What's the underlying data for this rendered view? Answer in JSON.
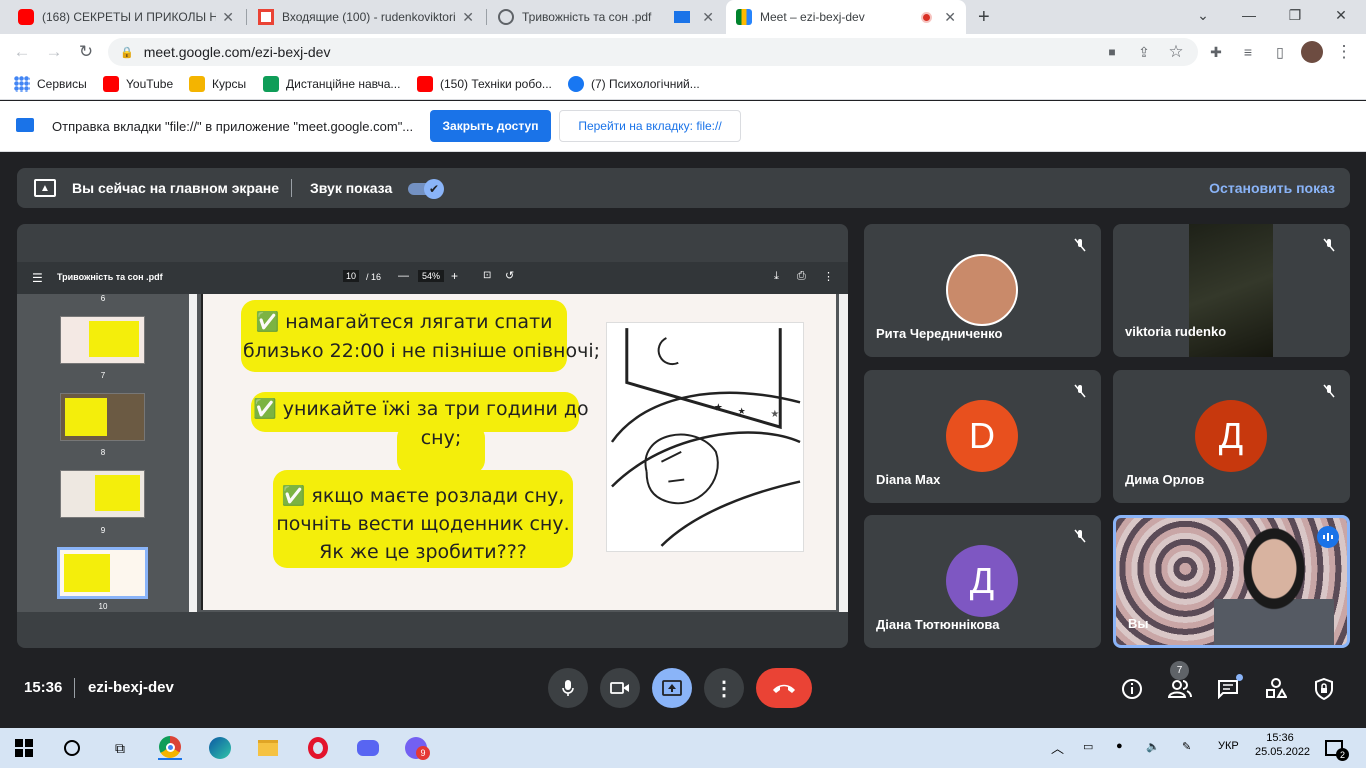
{
  "browser": {
    "tabs": [
      {
        "title": "(168) СЕКРЕТЫ И ПРИКОЛЫ НО",
        "icon": "youtube-icon"
      },
      {
        "title": "Входящие (100) - rudenkoviktori",
        "icon": "gmail-icon"
      },
      {
        "title": "Тривожність та сон .pdf",
        "icon": "globe-icon"
      },
      {
        "title": "Meet – ezi-bexj-dev",
        "icon": "meet-icon",
        "active": true
      }
    ],
    "url": "meet.google.com/ezi-bexj-dev",
    "bookmarks": [
      {
        "label": "Сервисы",
        "color": "#4285f4"
      },
      {
        "label": "YouTube",
        "color": "#ff0000"
      },
      {
        "label": "Курсы",
        "color": "#f4b400"
      },
      {
        "label": "Дистанційне навча...",
        "color": "#0f9d58"
      },
      {
        "label": "(150) Техніки робо...",
        "color": "#ff0000"
      },
      {
        "label": "(7) Психологічний...",
        "color": "#1877f2"
      }
    ],
    "infobar": {
      "message": "Отправка вкладки \"file://\" в приложение \"meet.google.com\"...",
      "primary": "Закрыть доступ",
      "secondary": "Перейти на вкладку: file://"
    }
  },
  "meet": {
    "present_bar": {
      "status": "Вы сейчас на главном экране",
      "sound_label": "Звук показа",
      "sound_on": true,
      "stop": "Остановить показ"
    },
    "pdf": {
      "filename": "Тривожність та сон .pdf",
      "page": "10",
      "pages": "/ 16",
      "zoom": "54%",
      "thumbnails": [
        "6",
        "7",
        "8",
        "9",
        "10"
      ],
      "slide_lines": {
        "l1": "✅ намагайтеся лягати спати",
        "l2": "близько 22:00 і не пізніше опівночі;",
        "l3": "✅ уникайте їжі за три години до",
        "l4": "сну;",
        "l5": "✅ якщо маєте розлади сну,",
        "l6": "почніть вести щоденник сну.",
        "l7": "Як же це зробити???"
      }
    },
    "participants": [
      {
        "name": "Рита Чередниченко",
        "type": "photo"
      },
      {
        "name": "viktoria rudenko",
        "type": "video"
      },
      {
        "name": "Diana Max",
        "initial": "D",
        "color": "#e8501e"
      },
      {
        "name": "Дима Орлов",
        "initial": "Д",
        "color": "#c7380d"
      },
      {
        "name": "Діана Тютюннікова",
        "initial": "Д",
        "color": "#7e57c2"
      },
      {
        "name": "Вы",
        "type": "self"
      }
    ],
    "time": "15:36",
    "code": "ezi-bexj-dev",
    "people_count": "7"
  },
  "taskbar": {
    "lang": "УКР",
    "clock_time": "15:36",
    "clock_date": "25.05.2022",
    "notifications": "2",
    "viber_badge": "9"
  }
}
